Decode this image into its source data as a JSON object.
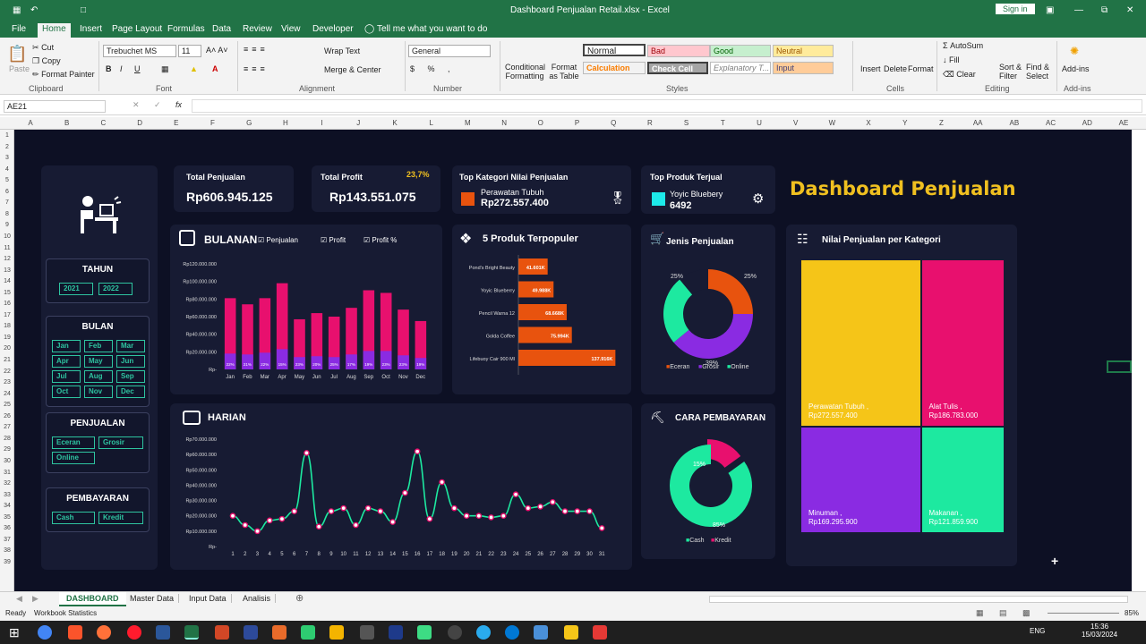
{
  "window": {
    "title": "Dashboard Penjualan Retail.xlsx  -  Excel",
    "signin": "Sign in"
  },
  "menu": [
    "File",
    "Home",
    "Insert",
    "Page Layout",
    "Formulas",
    "Data",
    "Review",
    "View",
    "Developer",
    "Tell me what you want to do"
  ],
  "ribbon": {
    "clipboard": {
      "paste": "Paste",
      "cut": "Cut",
      "copy": "Copy",
      "painter": "Format Painter",
      "group": "Clipboard"
    },
    "font": {
      "name": "Trebuchet MS",
      "size": "11",
      "group": "Font"
    },
    "alignment": {
      "wrap": "Wrap Text",
      "merge": "Merge & Center",
      "group": "Alignment"
    },
    "number": {
      "format": "General",
      "group": "Number"
    },
    "styles": {
      "cond": "Conditional Formatting",
      "table": "Format as Table",
      "normal": "Normal",
      "bad": "Bad",
      "good": "Good",
      "neutral": "Neutral",
      "calc": "Calculation",
      "check": "Check Cell",
      "explan": "Explanatory T...",
      "input": "Input",
      "group": "Styles"
    },
    "cells": {
      "insert": "Insert",
      "delete": "Delete",
      "format": "Format",
      "group": "Cells"
    },
    "editing": {
      "autosum": "AutoSum",
      "fill": "Fill",
      "clear": "Clear",
      "sort": "Sort & Filter",
      "find": "Find & Select",
      "group": "Editing"
    },
    "addins": {
      "label": "Add-ins",
      "group": "Add-ins"
    }
  },
  "namebox": "AE21",
  "columns": [
    "A",
    "B",
    "C",
    "D",
    "E",
    "F",
    "G",
    "H",
    "I",
    "J",
    "K",
    "L",
    "M",
    "N",
    "O",
    "P",
    "Q",
    "R",
    "S",
    "T",
    "U",
    "V",
    "W",
    "X",
    "Y",
    "Z",
    "AA",
    "AB",
    "AC",
    "AD",
    "AE"
  ],
  "rows": [
    "1",
    "2",
    "3",
    "4",
    "5",
    "6",
    "7",
    "8",
    "9",
    "10",
    "11",
    "12",
    "13",
    "14",
    "15",
    "16",
    "17",
    "18",
    "19",
    "20",
    "21",
    "22",
    "23",
    "24",
    "25",
    "26",
    "27",
    "28",
    "29",
    "30",
    "31",
    "32",
    "33",
    "34",
    "35",
    "36",
    "37",
    "38",
    "39"
  ],
  "dashboard": {
    "title": "Dashboard Penjualan",
    "kpi": {
      "total_sales_label": "Total Penjualan",
      "total_sales": "Rp606.945.125",
      "total_profit_label": "Total Profit",
      "total_profit": "Rp143.551.075",
      "profit_pct": "23,7%",
      "top_cat_label": "Top Kategori Nilai Penjualan",
      "top_cat_name": "Perawatan Tubuh",
      "top_cat_value": "Rp272.557.400",
      "top_prod_label": "Top Produk Terjual",
      "top_prod_name": "Yoyic Bluebery",
      "top_prod_value": "6492"
    },
    "slicers": {
      "tahun": {
        "title": "TAHUN",
        "items": [
          "2021",
          "2022"
        ]
      },
      "bulan": {
        "title": "BULAN",
        "items": [
          "Jan",
          "Feb",
          "Mar",
          "Apr",
          "May",
          "Jun",
          "Jul",
          "Aug",
          "Sep",
          "Oct",
          "Nov",
          "Dec"
        ]
      },
      "penjualan": {
        "title": "PENJUALAN",
        "items": [
          "Eceran",
          "Grosir",
          "Online"
        ]
      },
      "pembayaran": {
        "title": "PEMBAYARAN",
        "items": [
          "Cash",
          "Kredit"
        ]
      }
    },
    "monthly": {
      "title": "BULANAN",
      "legend": [
        "Penjualan",
        "Profit",
        "Profit %"
      ],
      "ticks": [
        "Rp120.000.000",
        "Rp100.000.000",
        "Rp80.000.000",
        "Rp60.000.000",
        "Rp40.000.000",
        "Rp20.000.000",
        "Rp-"
      ]
    },
    "top5": {
      "title": "5 Produk Terpopuler"
    },
    "jenis": {
      "title": "Jenis Penjualan",
      "legend": [
        "Eceran",
        "Grosir",
        "Online"
      ]
    },
    "kategori": {
      "title": "Nilai Penjualan per Kategori"
    },
    "harian": {
      "title": "HARIAN",
      "ticks": [
        "Rp70.000.000",
        "Rp60.000.000",
        "Rp50.000.000",
        "Rp40.000.000",
        "Rp30.000.000",
        "Rp20.000.000",
        "Rp10.000.000",
        "Rp-"
      ]
    },
    "bayar": {
      "title": "CARA PEMBAYARAN",
      "legend": [
        "Cash",
        "Kredit"
      ]
    }
  },
  "colors": {
    "pink": "#e8106e",
    "purple": "#8a2be2",
    "orange": "#e8530e",
    "yellow": "#f5c518",
    "teal": "#1de9a0",
    "gold": "#f0c020"
  },
  "chart_data": [
    {
      "type": "bar",
      "title": "BULANAN",
      "categories": [
        "Jan",
        "Feb",
        "Mar",
        "Apr",
        "May",
        "Jun",
        "Jul",
        "Aug",
        "Sep",
        "Oct",
        "Nov",
        "Dec"
      ],
      "series": [
        {
          "name": "Penjualan",
          "values": [
            81000000,
            74000000,
            81000000,
            98000000,
            57000000,
            64000000,
            60000000,
            70000000,
            90000000,
            87000000,
            68000000,
            55000000
          ]
        },
        {
          "name": "Profit",
          "values": [
            18000000,
            17000000,
            19000000,
            23000000,
            14000000,
            15000000,
            14000000,
            17000000,
            21000000,
            21000000,
            16000000,
            13000000
          ]
        },
        {
          "name": "Profit %",
          "values": [
            22,
            21,
            22,
            15,
            23,
            20,
            25,
            17,
            19,
            23,
            23,
            19
          ],
          "labels": [
            "22%",
            "21%",
            "22%",
            "15%",
            "23%",
            "20%",
            "25%",
            "17%",
            "19%",
            "23%",
            "23%",
            "19%"
          ]
        }
      ],
      "ylim": [
        0,
        120000000
      ]
    },
    {
      "type": "bar",
      "title": "5 Produk Terpopuler",
      "categories": [
        "Pond's Bright Beauty",
        "Yoyic Blueberry",
        "Pencil Warna 12",
        "Golda Coffee",
        "Lifebuoy Cair 900 Ml"
      ],
      "values": [
        41.601,
        49.988,
        68.668,
        75.994,
        137.916
      ],
      "labels": [
        "41.601K",
        "49.988K",
        "68.668K",
        "75.994K",
        "137.916K"
      ]
    },
    {
      "type": "pie",
      "title": "Jenis Penjualan",
      "categories": [
        "Eceran",
        "Grosir",
        "Online"
      ],
      "values": [
        25,
        39,
        25
      ],
      "labels": [
        "25%",
        "39%",
        "25%"
      ]
    },
    {
      "type": "heatmap",
      "title": "Nilai Penjualan per Kategori",
      "categories": [
        "Perawatan Tubuh",
        "Alat Tulis",
        "Minuman",
        "Makanan"
      ],
      "values": [
        272557400,
        186783000,
        169295900,
        121859900
      ],
      "labels": [
        "Rp272.557.400",
        "Rp186.783.000",
        "Rp169.295.900",
        "Rp121.859.900"
      ]
    },
    {
      "type": "line",
      "title": "HARIAN",
      "x": [
        1,
        2,
        3,
        4,
        5,
        6,
        7,
        8,
        9,
        10,
        11,
        12,
        13,
        14,
        15,
        16,
        17,
        18,
        19,
        20,
        21,
        22,
        23,
        24,
        25,
        26,
        27,
        28,
        29,
        30,
        31
      ],
      "values": [
        20000000,
        14000000,
        10000000,
        17000000,
        18000000,
        23000000,
        61000000,
        13000000,
        23000000,
        25000000,
        14000000,
        25000000,
        23000000,
        16000000,
        35000000,
        62000000,
        18000000,
        42000000,
        25000000,
        20000000,
        20000000,
        19000000,
        20000000,
        34000000,
        25000000,
        26000000,
        29000000,
        23000000,
        23000000,
        23000000,
        12000000
      ],
      "ylim": [
        0,
        70000000
      ]
    },
    {
      "type": "pie",
      "title": "CARA PEMBAYARAN",
      "categories": [
        "Cash",
        "Kredit"
      ],
      "values": [
        85,
        15
      ],
      "labels": [
        "85%",
        "15%"
      ]
    }
  ],
  "sheets": [
    "DASHBOARD",
    "Master Data",
    "Input Data",
    "Analisis"
  ],
  "status": {
    "ready": "Ready",
    "stats": "Workbook Statistics",
    "zoom": "85%",
    "lang": "ENG",
    "time": "15:36",
    "date": "15/03/2024"
  }
}
